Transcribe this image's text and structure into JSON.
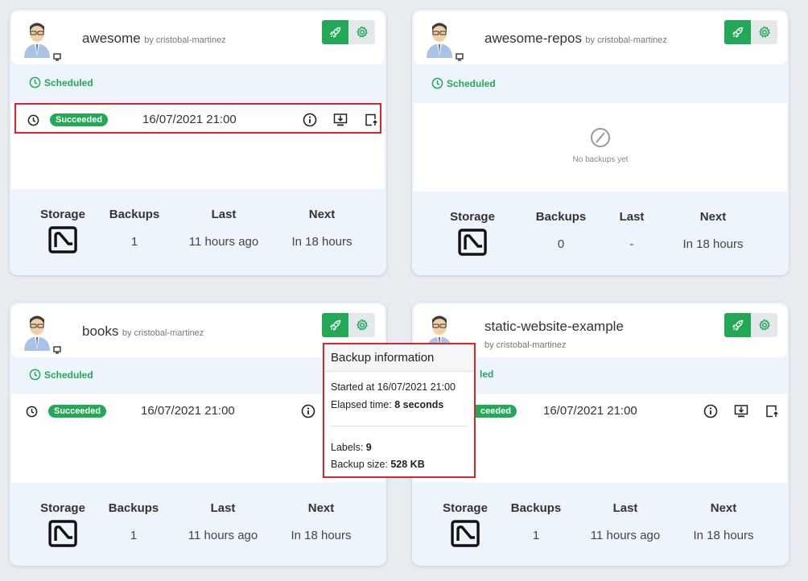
{
  "cards": [
    {
      "repo_name": "awesome",
      "author": "by cristobal-martinez",
      "scheduled_label": "Scheduled",
      "backup": {
        "status": "Succeeded",
        "date": "16/07/2021 21:00"
      },
      "stats": {
        "storage_label": "Storage",
        "backups_label": "Backups",
        "last_label": "Last",
        "next_label": "Next",
        "backups_value": "1",
        "last_value": "11 hours ago",
        "next_value": "In 18 hours"
      }
    },
    {
      "repo_name": "awesome-repos",
      "author": "by cristobal-martinez",
      "scheduled_label": "Scheduled",
      "empty_text": "No backups yet",
      "stats": {
        "storage_label": "Storage",
        "backups_label": "Backups",
        "last_label": "Last",
        "next_label": "Next",
        "backups_value": "0",
        "last_value": "-",
        "next_value": "In 18 hours"
      }
    },
    {
      "repo_name": "books",
      "author": "by cristobal-martinez",
      "scheduled_label": "Scheduled",
      "backup": {
        "status": "Succeeded",
        "date": "16/07/2021 21:00"
      },
      "stats": {
        "storage_label": "Storage",
        "backups_label": "Backups",
        "last_label": "Last",
        "next_label": "Next",
        "backups_value": "1",
        "last_value": "11 hours ago",
        "next_value": "In 18 hours"
      }
    },
    {
      "repo_name": "static-website-example",
      "author": "by cristobal-martinez",
      "scheduled_label": "led",
      "backup": {
        "status": "ceeded",
        "date": "16/07/2021 21:00"
      },
      "stats": {
        "storage_label": "Storage",
        "backups_label": "Backups",
        "last_label": "Last",
        "next_label": "Next",
        "backups_value": "1",
        "last_value": "11 hours ago",
        "next_value": "In 18 hours"
      }
    }
  ],
  "tooltip": {
    "title": "Backup information",
    "started": "Started at 16/07/2021 21:00",
    "elapsed_label": "Elapsed time: ",
    "elapsed_value": "8 seconds",
    "labels_label": "Labels: ",
    "labels_value": "9",
    "size_label": "Backup size: ",
    "size_value": "528 KB"
  },
  "colors": {
    "accent": "#23a955",
    "highlight": "#d9262a",
    "card_bg": "#eef4fb"
  }
}
